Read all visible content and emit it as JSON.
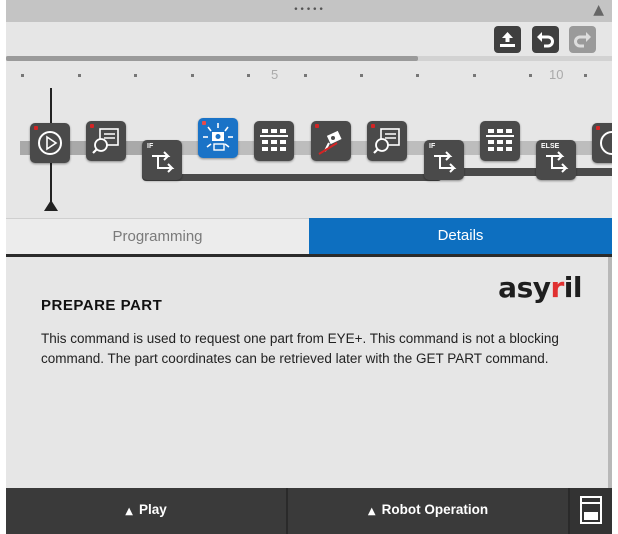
{
  "topbar": {
    "grip": "•••••",
    "collapse": "▲"
  },
  "toolbar": {
    "upload_icon": "upload-icon",
    "undo_icon": "undo-icon",
    "redo_icon": "redo-icon"
  },
  "timeline": {
    "markers": [
      "5",
      "10"
    ]
  },
  "program": {
    "blocks": [
      {
        "name": "start",
        "icon": "play-circle-icon"
      },
      {
        "name": "prepare-part-search",
        "icon": "magnifier-icon"
      },
      {
        "name": "if",
        "label": "IF",
        "icon": "branch-icon"
      },
      {
        "name": "prepare-part",
        "icon": "vision-camera-icon",
        "active": true
      },
      {
        "name": "parts-grid",
        "icon": "parts-grid-icon"
      },
      {
        "name": "robot-pick",
        "icon": "robot-icon"
      },
      {
        "name": "search",
        "icon": "magnifier-icon"
      },
      {
        "name": "if-2",
        "label": "IF",
        "icon": "branch-icon"
      },
      {
        "name": "parts-grid-2",
        "icon": "parts-grid-icon"
      },
      {
        "name": "else",
        "label": "ELSE",
        "icon": "branch-icon"
      }
    ]
  },
  "tabs": [
    {
      "label": "Programming",
      "active": false
    },
    {
      "label": "Details",
      "active": true
    }
  ],
  "details": {
    "logo": "asyril",
    "title": "PREPARE PART",
    "description": "This command is used to request one part from EYE+. This command is not a blocking command. The part coordinates can be retrieved later with the GET PART command."
  },
  "bottombar": {
    "play_label": "Play",
    "robot_label": "Robot Operation",
    "arrow": "▲"
  },
  "colors": {
    "accent": "#0d6fc0",
    "block": "#4a4a4a",
    "dark_bar": "#3a3a3a",
    "logo_dot": "#e03030"
  }
}
